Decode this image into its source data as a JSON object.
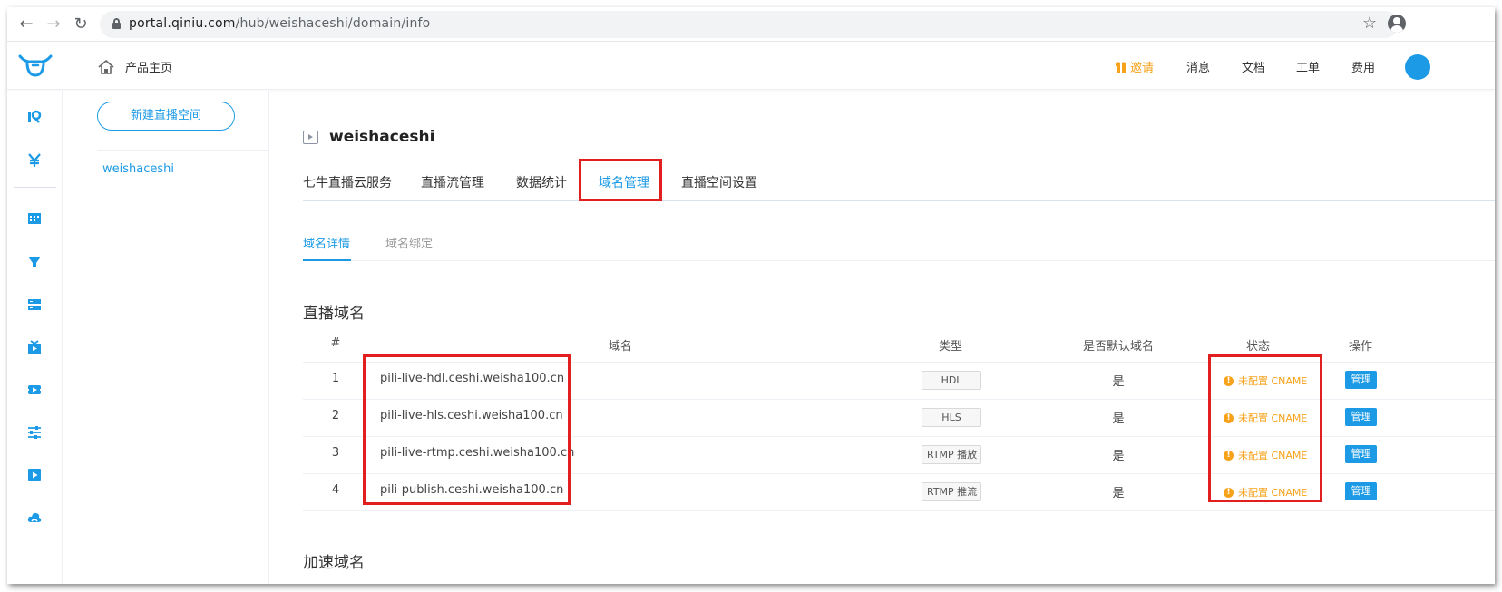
{
  "browser": {
    "url_host": "portal.qiniu.com",
    "url_path": "/hub/weishaceshi/domain/info"
  },
  "header": {
    "home_label": "产品主页",
    "invite_label": "邀请",
    "messages_label": "消息",
    "docs_label": "文档",
    "tickets_label": "工单",
    "billing_label": "费用"
  },
  "sidebar": {
    "new_space_label": "新建直播空间",
    "spaces": [
      "weishaceshi"
    ]
  },
  "main": {
    "space_title": "weishaceshi",
    "tabs": [
      {
        "label": "七牛直播云服务",
        "active": false
      },
      {
        "label": "直播流管理",
        "active": false
      },
      {
        "label": "数据统计",
        "active": false
      },
      {
        "label": "域名管理",
        "active": true
      },
      {
        "label": "直播空间设置",
        "active": false
      }
    ],
    "subtabs": [
      {
        "label": "域名详情",
        "active": true
      },
      {
        "label": "域名绑定",
        "active": false
      }
    ],
    "section_title": "直播域名",
    "next_section_title": "加速域名",
    "table": {
      "columns": [
        "#",
        "域名",
        "类型",
        "是否默认域名",
        "状态",
        "操作"
      ],
      "rows": [
        {
          "index": "1",
          "domain": "pili-live-hdl.ceshi.weisha100.cn",
          "type": "HDL",
          "default": "是",
          "status": "未配置 CNAME",
          "action": "管理"
        },
        {
          "index": "2",
          "domain": "pili-live-hls.ceshi.weisha100.cn",
          "type": "HLS",
          "default": "是",
          "status": "未配置 CNAME",
          "action": "管理"
        },
        {
          "index": "3",
          "domain": "pili-live-rtmp.ceshi.weisha100.cn",
          "type": "RTMP 播放",
          "default": "是",
          "status": "未配置 CNAME",
          "action": "管理"
        },
        {
          "index": "4",
          "domain": "pili-publish.ceshi.weisha100.cn",
          "type": "RTMP 推流",
          "default": "是",
          "status": "未配置 CNAME",
          "action": "管理"
        }
      ]
    }
  },
  "colors": {
    "accent": "#1c9ae6",
    "warning": "#f7a21b",
    "highlight": "#e21f1f"
  }
}
